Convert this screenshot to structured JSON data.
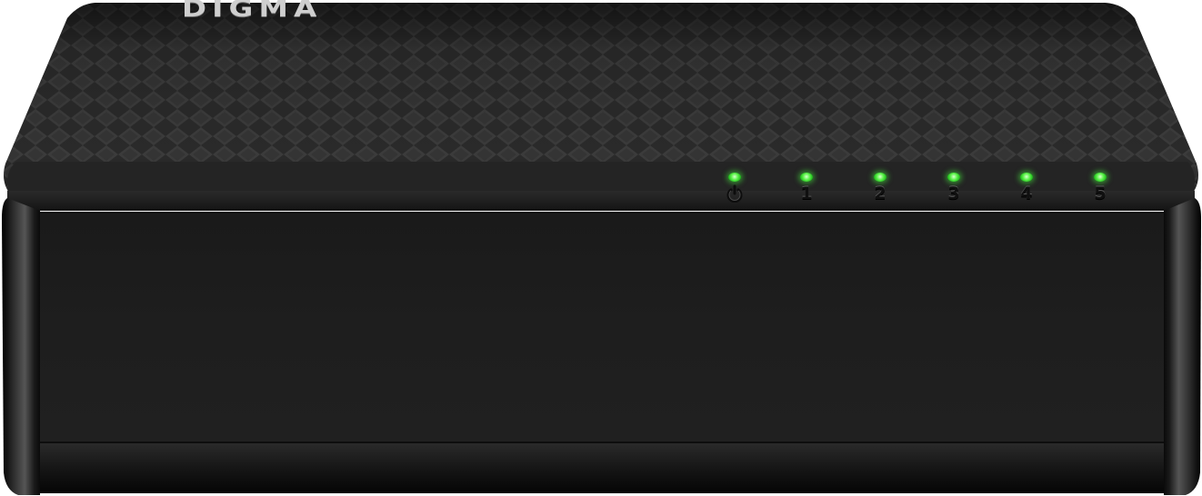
{
  "product": {
    "brand": "DIGMA",
    "body_color": "#1d1d1d",
    "led_color": "#4cef3c"
  },
  "indicators": [
    {
      "label": "",
      "icon": "power-icon",
      "state": "on"
    },
    {
      "label": "1",
      "icon": "",
      "state": "on"
    },
    {
      "label": "2",
      "icon": "",
      "state": "on"
    },
    {
      "label": "3",
      "icon": "",
      "state": "on"
    },
    {
      "label": "4",
      "icon": "",
      "state": "on"
    },
    {
      "label": "5",
      "icon": "",
      "state": "on"
    }
  ]
}
